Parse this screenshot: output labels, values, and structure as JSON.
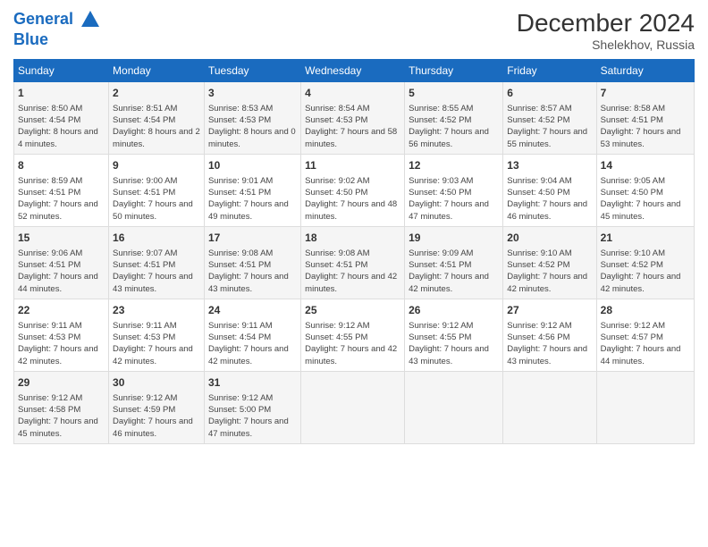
{
  "logo": {
    "line1": "General",
    "line2": "Blue"
  },
  "title": "December 2024",
  "location": "Shelekhov, Russia",
  "columns": [
    "Sunday",
    "Monday",
    "Tuesday",
    "Wednesday",
    "Thursday",
    "Friday",
    "Saturday"
  ],
  "weeks": [
    [
      {
        "day": "1",
        "sunrise": "Sunrise: 8:50 AM",
        "sunset": "Sunset: 4:54 PM",
        "daylight": "Daylight: 8 hours and 4 minutes."
      },
      {
        "day": "2",
        "sunrise": "Sunrise: 8:51 AM",
        "sunset": "Sunset: 4:54 PM",
        "daylight": "Daylight: 8 hours and 2 minutes."
      },
      {
        "day": "3",
        "sunrise": "Sunrise: 8:53 AM",
        "sunset": "Sunset: 4:53 PM",
        "daylight": "Daylight: 8 hours and 0 minutes."
      },
      {
        "day": "4",
        "sunrise": "Sunrise: 8:54 AM",
        "sunset": "Sunset: 4:53 PM",
        "daylight": "Daylight: 7 hours and 58 minutes."
      },
      {
        "day": "5",
        "sunrise": "Sunrise: 8:55 AM",
        "sunset": "Sunset: 4:52 PM",
        "daylight": "Daylight: 7 hours and 56 minutes."
      },
      {
        "day": "6",
        "sunrise": "Sunrise: 8:57 AM",
        "sunset": "Sunset: 4:52 PM",
        "daylight": "Daylight: 7 hours and 55 minutes."
      },
      {
        "day": "7",
        "sunrise": "Sunrise: 8:58 AM",
        "sunset": "Sunset: 4:51 PM",
        "daylight": "Daylight: 7 hours and 53 minutes."
      }
    ],
    [
      {
        "day": "8",
        "sunrise": "Sunrise: 8:59 AM",
        "sunset": "Sunset: 4:51 PM",
        "daylight": "Daylight: 7 hours and 52 minutes."
      },
      {
        "day": "9",
        "sunrise": "Sunrise: 9:00 AM",
        "sunset": "Sunset: 4:51 PM",
        "daylight": "Daylight: 7 hours and 50 minutes."
      },
      {
        "day": "10",
        "sunrise": "Sunrise: 9:01 AM",
        "sunset": "Sunset: 4:51 PM",
        "daylight": "Daylight: 7 hours and 49 minutes."
      },
      {
        "day": "11",
        "sunrise": "Sunrise: 9:02 AM",
        "sunset": "Sunset: 4:50 PM",
        "daylight": "Daylight: 7 hours and 48 minutes."
      },
      {
        "day": "12",
        "sunrise": "Sunrise: 9:03 AM",
        "sunset": "Sunset: 4:50 PM",
        "daylight": "Daylight: 7 hours and 47 minutes."
      },
      {
        "day": "13",
        "sunrise": "Sunrise: 9:04 AM",
        "sunset": "Sunset: 4:50 PM",
        "daylight": "Daylight: 7 hours and 46 minutes."
      },
      {
        "day": "14",
        "sunrise": "Sunrise: 9:05 AM",
        "sunset": "Sunset: 4:50 PM",
        "daylight": "Daylight: 7 hours and 45 minutes."
      }
    ],
    [
      {
        "day": "15",
        "sunrise": "Sunrise: 9:06 AM",
        "sunset": "Sunset: 4:51 PM",
        "daylight": "Daylight: 7 hours and 44 minutes."
      },
      {
        "day": "16",
        "sunrise": "Sunrise: 9:07 AM",
        "sunset": "Sunset: 4:51 PM",
        "daylight": "Daylight: 7 hours and 43 minutes."
      },
      {
        "day": "17",
        "sunrise": "Sunrise: 9:08 AM",
        "sunset": "Sunset: 4:51 PM",
        "daylight": "Daylight: 7 hours and 43 minutes."
      },
      {
        "day": "18",
        "sunrise": "Sunrise: 9:08 AM",
        "sunset": "Sunset: 4:51 PM",
        "daylight": "Daylight: 7 hours and 42 minutes."
      },
      {
        "day": "19",
        "sunrise": "Sunrise: 9:09 AM",
        "sunset": "Sunset: 4:51 PM",
        "daylight": "Daylight: 7 hours and 42 minutes."
      },
      {
        "day": "20",
        "sunrise": "Sunrise: 9:10 AM",
        "sunset": "Sunset: 4:52 PM",
        "daylight": "Daylight: 7 hours and 42 minutes."
      },
      {
        "day": "21",
        "sunrise": "Sunrise: 9:10 AM",
        "sunset": "Sunset: 4:52 PM",
        "daylight": "Daylight: 7 hours and 42 minutes."
      }
    ],
    [
      {
        "day": "22",
        "sunrise": "Sunrise: 9:11 AM",
        "sunset": "Sunset: 4:53 PM",
        "daylight": "Daylight: 7 hours and 42 minutes."
      },
      {
        "day": "23",
        "sunrise": "Sunrise: 9:11 AM",
        "sunset": "Sunset: 4:53 PM",
        "daylight": "Daylight: 7 hours and 42 minutes."
      },
      {
        "day": "24",
        "sunrise": "Sunrise: 9:11 AM",
        "sunset": "Sunset: 4:54 PM",
        "daylight": "Daylight: 7 hours and 42 minutes."
      },
      {
        "day": "25",
        "sunrise": "Sunrise: 9:12 AM",
        "sunset": "Sunset: 4:55 PM",
        "daylight": "Daylight: 7 hours and 42 minutes."
      },
      {
        "day": "26",
        "sunrise": "Sunrise: 9:12 AM",
        "sunset": "Sunset: 4:55 PM",
        "daylight": "Daylight: 7 hours and 43 minutes."
      },
      {
        "day": "27",
        "sunrise": "Sunrise: 9:12 AM",
        "sunset": "Sunset: 4:56 PM",
        "daylight": "Daylight: 7 hours and 43 minutes."
      },
      {
        "day": "28",
        "sunrise": "Sunrise: 9:12 AM",
        "sunset": "Sunset: 4:57 PM",
        "daylight": "Daylight: 7 hours and 44 minutes."
      }
    ],
    [
      {
        "day": "29",
        "sunrise": "Sunrise: 9:12 AM",
        "sunset": "Sunset: 4:58 PM",
        "daylight": "Daylight: 7 hours and 45 minutes."
      },
      {
        "day": "30",
        "sunrise": "Sunrise: 9:12 AM",
        "sunset": "Sunset: 4:59 PM",
        "daylight": "Daylight: 7 hours and 46 minutes."
      },
      {
        "day": "31",
        "sunrise": "Sunrise: 9:12 AM",
        "sunset": "Sunset: 5:00 PM",
        "daylight": "Daylight: 7 hours and 47 minutes."
      },
      {
        "day": "",
        "sunrise": "",
        "sunset": "",
        "daylight": ""
      },
      {
        "day": "",
        "sunrise": "",
        "sunset": "",
        "daylight": ""
      },
      {
        "day": "",
        "sunrise": "",
        "sunset": "",
        "daylight": ""
      },
      {
        "day": "",
        "sunrise": "",
        "sunset": "",
        "daylight": ""
      }
    ]
  ]
}
